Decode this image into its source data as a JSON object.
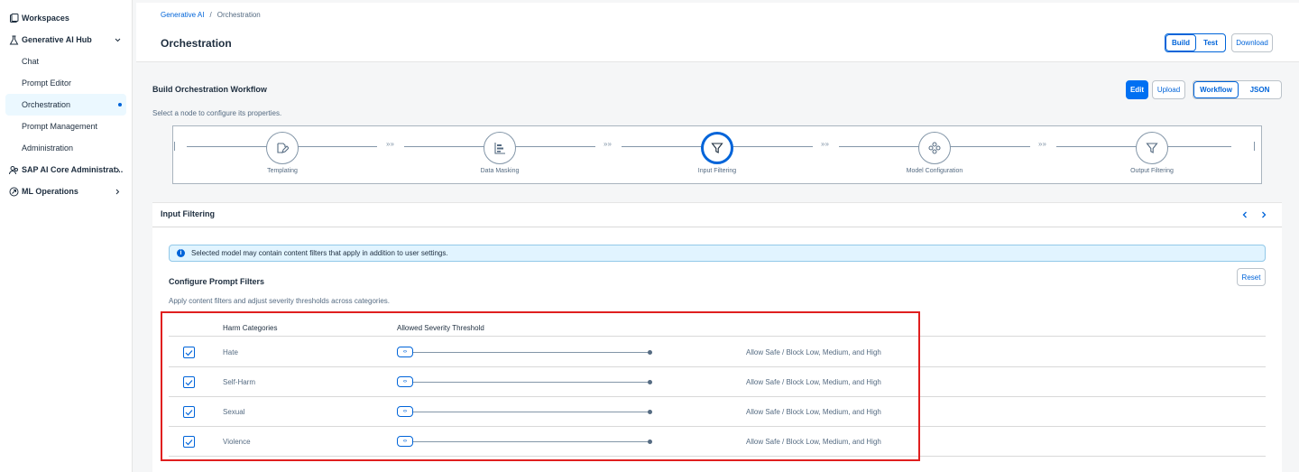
{
  "sidebar": {
    "items": [
      {
        "label": "Workspaces",
        "icon": "workspaces-icon"
      },
      {
        "label": "Generative AI Hub",
        "icon": "genai-hub-icon",
        "expanded": true,
        "children": [
          {
            "label": "Chat"
          },
          {
            "label": "Prompt Editor"
          },
          {
            "label": "Orchestration",
            "active": true
          },
          {
            "label": "Prompt Management"
          },
          {
            "label": "Administration"
          }
        ]
      },
      {
        "label": "SAP AI Core Administrat...",
        "icon": "people-icon"
      },
      {
        "label": "ML Operations",
        "icon": "ml-ops-icon"
      }
    ]
  },
  "header": {
    "breadcrumb": [
      "Generative AI",
      "/",
      "Orchestration"
    ],
    "title": "Orchestration",
    "tabs": [
      "Build",
      "Test"
    ],
    "selected_tab": "Build",
    "download_label": "Download"
  },
  "workflow": {
    "title": "Build Orchestration Workflow",
    "subtitle": "Select a node to configure its properties.",
    "edit_label": "Edit",
    "upload_label": "Upload",
    "view_modes": [
      "Workflow",
      "JSON"
    ],
    "selected_view": "Workflow",
    "arrow_glyph": "»»",
    "nodes": [
      {
        "label": "Templating",
        "icon": "templating-icon"
      },
      {
        "label": "Data Masking",
        "icon": "data-masking-icon"
      },
      {
        "label": "Input Filtering",
        "icon": "filter-icon",
        "selected": true
      },
      {
        "label": "Model Configuration",
        "icon": "model-config-icon"
      },
      {
        "label": "Output Filtering",
        "icon": "filter-icon"
      }
    ]
  },
  "panel": {
    "title": "Input Filtering",
    "info_text": "Selected model may contain content filters that apply in addition to user settings.",
    "config_title": "Configure Prompt Filters",
    "config_subtitle": "Apply content filters and adjust severity thresholds across categories.",
    "reset_label": "Reset",
    "columns": [
      "Harm Categories",
      "Allowed Severity Threshold"
    ],
    "rows": [
      {
        "category": "Hate",
        "checked": true,
        "threshold": 0,
        "status": "Allow Safe / Block Low, Medium, and High"
      },
      {
        "category": "Self-Harm",
        "checked": true,
        "threshold": 0,
        "status": "Allow Safe / Block Low, Medium, and High"
      },
      {
        "category": "Sexual",
        "checked": true,
        "threshold": 0,
        "status": "Allow Safe / Block Low, Medium, and High"
      },
      {
        "category": "Violence",
        "checked": true,
        "threshold": 0,
        "status": "Allow Safe / Block Low, Medium, and High"
      }
    ]
  },
  "colors": {
    "accent": "#0064d9",
    "highlight": "#e01f1f",
    "info_bg": "#e1f4ff"
  }
}
